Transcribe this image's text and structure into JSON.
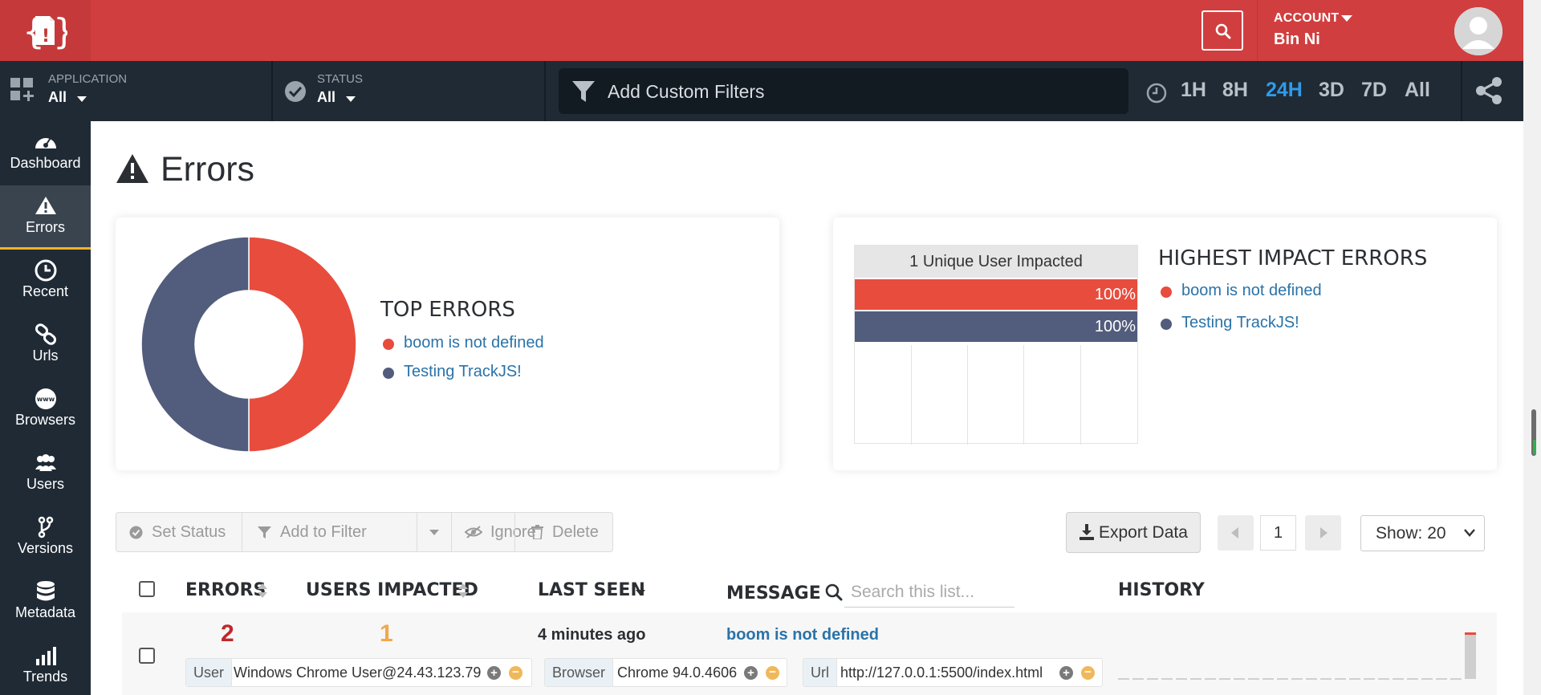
{
  "header": {
    "account_label": "ACCOUNT",
    "account_name": "Bin Ni"
  },
  "filters": {
    "application_label": "APPLICATION",
    "application_value": "All",
    "status_label": "STATUS",
    "status_value": "All",
    "custom_filter_text": "Add Custom Filters",
    "time_options": [
      "1H",
      "8H",
      "24H",
      "3D",
      "7D",
      "All"
    ],
    "active_time": "24H"
  },
  "sidebar": {
    "items": [
      {
        "label": "Dashboard",
        "icon": "dashboard-icon"
      },
      {
        "label": "Errors",
        "icon": "warning-icon",
        "active": true
      },
      {
        "label": "Recent",
        "icon": "clock-icon"
      },
      {
        "label": "Urls",
        "icon": "link-icon"
      },
      {
        "label": "Browsers",
        "icon": "www-icon"
      },
      {
        "label": "Users",
        "icon": "users-icon"
      },
      {
        "label": "Versions",
        "icon": "branch-icon"
      },
      {
        "label": "Metadata",
        "icon": "database-icon"
      },
      {
        "label": "Trends",
        "icon": "bar-chart-icon"
      }
    ]
  },
  "page": {
    "title": "Errors"
  },
  "top_errors": {
    "heading": "TOP ERRORS",
    "items": [
      {
        "label": "boom is not defined",
        "color": "#e84c3d"
      },
      {
        "label": "Testing TrackJS!",
        "color": "#525c7c"
      }
    ]
  },
  "highest_impact": {
    "heading": "HIGHEST IMPACT ERRORS",
    "chart_header": "1 Unique User Impacted",
    "bars": [
      {
        "label": "100%",
        "value": 100,
        "color": "#e84c3d"
      },
      {
        "label": "100%",
        "value": 100,
        "color": "#525c7c"
      }
    ],
    "items": [
      {
        "label": "boom is not defined",
        "color": "#e84c3d"
      },
      {
        "label": "Testing TrackJS!",
        "color": "#525c7c"
      }
    ]
  },
  "chart_data": {
    "type": "pie",
    "categories": [
      "boom is not defined",
      "Testing TrackJS!"
    ],
    "values": [
      50,
      50
    ],
    "colors": [
      "#e84c3d",
      "#525c7c"
    ],
    "title": "TOP ERRORS"
  },
  "toolbar": {
    "set_status": "Set Status",
    "add_to_filter": "Add to Filter",
    "ignore": "Ignore",
    "delete": "Delete",
    "export": "Export Data",
    "page": "1",
    "show": "Show: 20"
  },
  "table": {
    "headers": {
      "errors": "ERRORS",
      "users": "USERS IMPACTED",
      "last_seen": "LAST SEEN",
      "message": "MESSAGE",
      "history": "HISTORY"
    },
    "search_placeholder": "Search this list...",
    "rows": [
      {
        "errors": "2",
        "users": "1",
        "last_seen": "4 minutes ago",
        "message": "boom is not defined",
        "tags": [
          {
            "key": "User",
            "value": "Windows Chrome User@24.43.123.79"
          },
          {
            "key": "Browser",
            "value": "Chrome 94.0.4606"
          },
          {
            "key": "Url",
            "value": "http://127.0.0.1:5500/index.html"
          }
        ]
      }
    ]
  },
  "colors": {
    "brand_red": "#d13e3f",
    "nav_dark": "#1f2a35",
    "accent_blue": "#2f9be8",
    "active_underline": "#f0b323"
  }
}
